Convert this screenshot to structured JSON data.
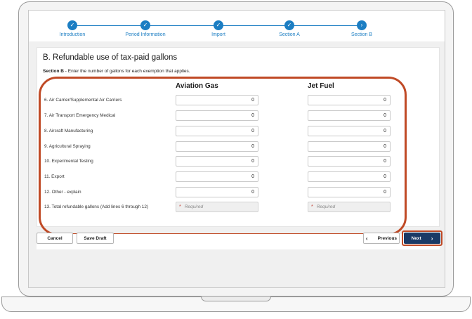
{
  "stepper": {
    "steps": [
      {
        "label": "Introduction",
        "state": "complete",
        "icon": "check-icon"
      },
      {
        "label": "Period Information",
        "state": "complete",
        "icon": "check-icon"
      },
      {
        "label": "Import",
        "state": "complete",
        "icon": "check-icon"
      },
      {
        "label": "Section A",
        "state": "complete",
        "icon": "check-icon"
      },
      {
        "label": "Section B",
        "state": "current",
        "icon": "chevron-right-icon"
      }
    ],
    "accent_color": "#1c7ec3"
  },
  "section": {
    "title": "B. Refundable use of tax-paid gallons",
    "desc_bold": "Section B",
    "desc_text": " - Enter the number of gallons for each exemption that applies."
  },
  "columns": {
    "aviation_gas": "Aviation Gas",
    "jet_fuel": "Jet Fuel"
  },
  "rows": [
    {
      "label": "6. Air Carrier/Supplemental Air Carriers",
      "aviation_gas": "0",
      "jet_fuel": "0"
    },
    {
      "label": "7. Air Transport Emergency Medical",
      "aviation_gas": "0",
      "jet_fuel": "0"
    },
    {
      "label": "8. Aircraft Manufacturing",
      "aviation_gas": "0",
      "jet_fuel": "0"
    },
    {
      "label": "9. Agricultural Spraying",
      "aviation_gas": "0",
      "jet_fuel": "0"
    },
    {
      "label": "10. Experimental Testing",
      "aviation_gas": "0",
      "jet_fuel": "0"
    },
    {
      "label": "11. Export",
      "aviation_gas": "0",
      "jet_fuel": "0"
    },
    {
      "label": "12. Other - explain",
      "aviation_gas": "0",
      "jet_fuel": "0"
    }
  ],
  "total_row": {
    "label": "13. Total refundable gallons (Add lines 6 through 12)",
    "required_star": "*",
    "aviation_gas_placeholder": "Required",
    "jet_fuel_placeholder": "Required"
  },
  "footer": {
    "cancel_label": "Cancel",
    "save_draft_label": "Save Draft",
    "previous_label": "Previous",
    "next_label": "Next",
    "next_color": "#1a3a66"
  },
  "highlight_color": "#c04a26"
}
